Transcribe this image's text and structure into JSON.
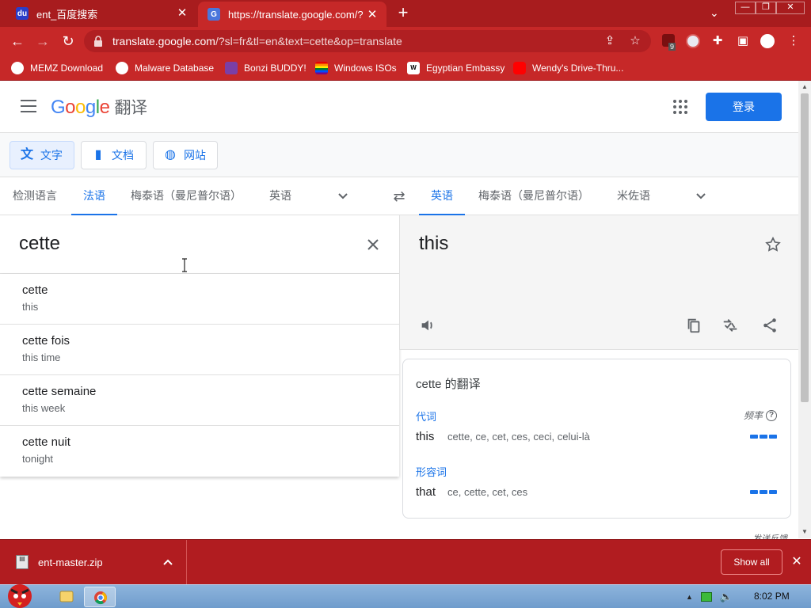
{
  "browser": {
    "tabs": [
      {
        "title": "ent_百度搜索",
        "favicon_text": "du"
      },
      {
        "title": "https://translate.google.com/?sl=",
        "favicon_text": "G"
      }
    ],
    "url_host": "translate.google.com",
    "url_rest": "/?sl=fr&tl=en&text=cette&op=translate",
    "extension_badge": "9",
    "bookmarks": [
      "MEMZ Download",
      "Malware Database",
      "Bonzi BUDDY!",
      "Windows ISOs",
      "Egyptian Embassy",
      "Wendy's Drive-Thru..."
    ],
    "theme_color": "#c62828"
  },
  "header": {
    "logo": [
      "G",
      "o",
      "o",
      "g",
      "l",
      "e"
    ],
    "product": "翻译",
    "signin_label": "登录"
  },
  "modes": [
    {
      "label": "文字"
    },
    {
      "label": "文档"
    },
    {
      "label": "网站"
    }
  ],
  "source_langs": [
    "检测语言",
    "法语",
    "梅泰语（曼尼普尔语）",
    "英语"
  ],
  "target_langs": [
    "英语",
    "梅泰语（曼尼普尔语）",
    "米佐语"
  ],
  "source_text": "cette",
  "suggestions": [
    {
      "text": "cette",
      "translation": "this"
    },
    {
      "text": "cette fois",
      "translation": "this time"
    },
    {
      "text": "cette semaine",
      "translation": "this week"
    },
    {
      "text": "cette nuit",
      "translation": "tonight"
    }
  ],
  "target_text": "this",
  "dictionary": {
    "title": "cette 的翻译",
    "frequency_label": "频率",
    "groups": [
      {
        "pos": "代词",
        "word": "this",
        "synonyms": "cette, ce, cet, ces, ceci, celui-là"
      },
      {
        "pos": "形容词",
        "word": "that",
        "synonyms": "ce, cette, cet, ces"
      }
    ]
  },
  "feedback_label": "发送反馈",
  "download": {
    "file": "ent-master.zip",
    "show_all": "Show all"
  },
  "taskbar": {
    "time": "8:02 PM"
  }
}
